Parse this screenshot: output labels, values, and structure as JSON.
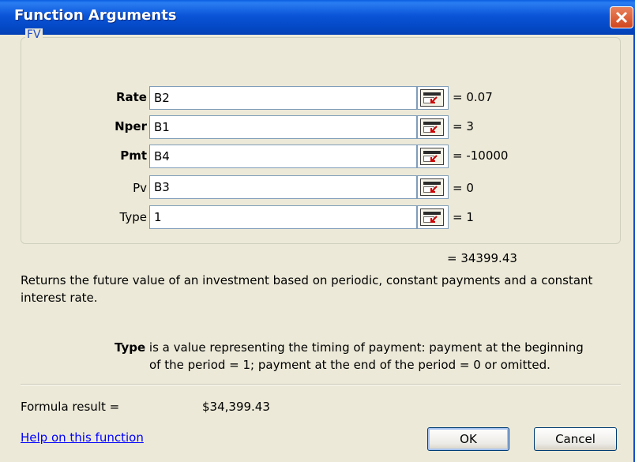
{
  "window": {
    "title": "Function Arguments"
  },
  "function_name": "FV",
  "arguments": [
    {
      "label": "Rate",
      "bold": true,
      "value": "B2",
      "evaluated": "= 0.07"
    },
    {
      "label": "Nper",
      "bold": true,
      "value": "B1",
      "evaluated": "= 3"
    },
    {
      "label": "Pmt",
      "bold": true,
      "value": "B4",
      "evaluated": "= -10000"
    },
    {
      "label": "Pv",
      "bold": false,
      "value": "B3",
      "evaluated": "= 0"
    },
    {
      "label": "Type",
      "bold": false,
      "value": "1",
      "evaluated": "= 1"
    }
  ],
  "result_preview": "= 34399.43",
  "description": "Returns the future value of an investment based on periodic, constant payments and a constant interest rate.",
  "arg_help": {
    "name": "Type",
    "text_line1": " is a value representing the timing of payment: payment at the beginning",
    "text_line2": "of the period = 1; payment at the end of the period = 0 or omitted."
  },
  "formula_result": {
    "label": "Formula result =",
    "value": "$34,399.43"
  },
  "help_link": "Help on this function",
  "buttons": {
    "ok": "OK",
    "cancel": "Cancel"
  },
  "icons": {
    "close": "close-icon",
    "ref": "collapse-dialog-icon"
  },
  "colors": {
    "titlebar": "#0a54d8",
    "close": "#d0461e",
    "link": "#0000ff",
    "dialog_bg": "#ece9d8"
  }
}
